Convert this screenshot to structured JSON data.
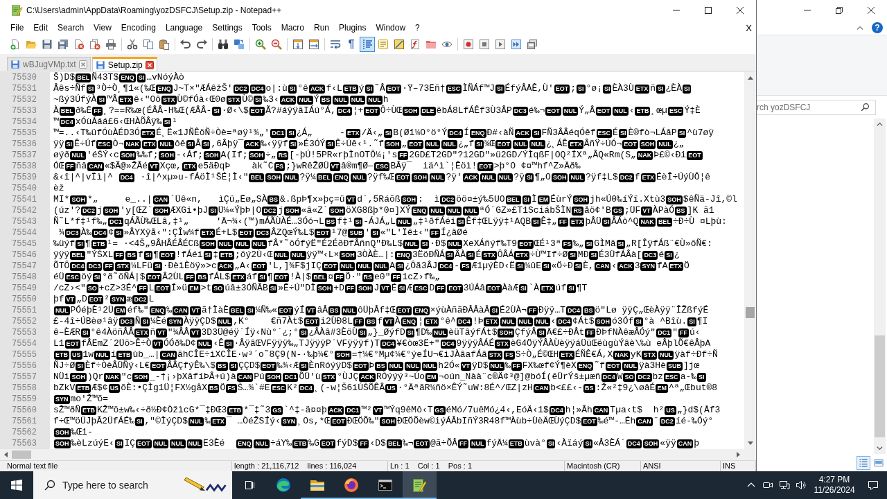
{
  "window": {
    "title": "C:\\Users\\admin\\AppData\\Roaming\\yozDSFCJ\\Setup.zip - Notepad++"
  },
  "menu": {
    "items": [
      "File",
      "Edit",
      "Search",
      "View",
      "Encoding",
      "Language",
      "Settings",
      "Tools",
      "Macro",
      "Run",
      "Plugins",
      "Window",
      "?"
    ],
    "close_glyph": "X"
  },
  "toolbar": {
    "buttons": [
      {
        "pressed": false
      },
      {
        "pressed": false
      },
      {
        "pressed": false
      },
      {
        "pressed": false
      },
      {
        "pressed": false
      },
      {
        "pressed": false
      },
      {
        "pressed": false
      },
      {
        "pressed": false
      },
      {
        "pressed": false
      },
      {
        "pressed": false
      },
      {
        "pressed": false
      },
      {
        "pressed": false
      },
      {
        "pressed": false
      },
      {
        "pressed": false
      },
      {
        "pressed": false
      },
      {
        "pressed": false
      },
      {
        "pressed": false
      },
      {
        "pressed": false
      },
      {
        "pressed": false
      },
      {
        "pressed": false,
        "glyph": "¶"
      },
      {
        "pressed": true
      },
      {
        "pressed": false
      },
      {
        "pressed": false
      },
      {
        "pressed": false
      },
      {
        "pressed": false
      },
      {
        "pressed": false
      },
      {
        "pressed": false
      },
      {
        "pressed": false
      },
      {
        "pressed": false
      },
      {
        "pressed": false
      },
      {
        "pressed": false
      }
    ]
  },
  "tabs": [
    {
      "label": "wBJugVMp.txt",
      "selected": false
    },
    {
      "label": "Setup.zip",
      "selected": true
    }
  ],
  "editor": {
    "lines": [
      {
        "number": "75530",
        "parts": [
          "Š)D$",
          {
            "code": "BEL"
          },
          "Ñ43T$",
          {
            "code": "ENQ"
          },
          {
            "code": "SI"
          },
          "…vNóýÀò"
        ]
      },
      {
        "number": "75531",
        "parts": [
          "Âês÷Ñf",
          {
            "code": "SI"
          },
          "³Ò÷Ò¸¶1«(‰Œ",
          {
            "code": "ENQ"
          },
          "J~T×\"ÆÁêžŠ'",
          {
            "code": "DC2"
          },
          {
            "code": "DC4"
          },
          "o|:ù",
          {
            "code": "SI"
          },
          "°ê",
          {
            "code": "ACK"
          },
          "f‹L",
          {
            "code": "ETB"
          },
          "ý",
          {
            "code": "SI"
          },
          "˜Â",
          {
            "code": "EOT"
          },
          "·Ÿ–73Ëñ†",
          {
            "code": "ESC"
          },
          "ÌÑÁf™J",
          {
            "code": "SI"
          },
          "ÉfýÂÅÊ,Ù'",
          {
            "code": "EOT"
          },
          ";",
          {
            "code": "SI"
          },
          "°ø¡",
          {
            "code": "SI"
          },
          "ÈÀ3Ù",
          {
            "code": "ETX"
          },
          "ñ",
          {
            "code": "SI"
          },
          "¿ÈÀ",
          {
            "code": "SI"
          }
        ]
      },
      {
        "number": "75532",
        "parts": [
          "~ßý3ÚfýÀ",
          {
            "code": "SI"
          },
          "™Â",
          {
            "code": "ETX"
          },
          "ê‹\"Oô",
          {
            "code": "STX"
          },
          "Ù©fÓà‹Œ0ø",
          {
            "code": "STX"
          },
          "Ù©",
          {
            "code": "SI"
          },
          "‰3‹",
          {
            "code": "ACK"
          },
          {
            "code": "NUL"
          },
          "Ý",
          {
            "code": "BS"
          },
          {
            "code": "NUL"
          },
          {
            "code": "NUL"
          },
          {
            "code": "NUL"
          },
          "h"
        ]
      },
      {
        "number": "75533",
        "parts": [
          "À",
          {
            "code": "BEL"
          },
          "ð‰Ë",
          {
            "code": "FF"
          },
          "¸?==R‰œ(ÉÂÂ-H‰Œ(ÆÂÂ-",
          {
            "code": "SI"
          },
          "·Ø‹\\$",
          {
            "code": "EOT"
          },
          "Ã?#áÿÿãIÁú°Á,",
          {
            "code": "DC4"
          },
          "¦+",
          {
            "code": "EOT"
          },
          "Ô÷ÙŒ",
          {
            "code": "SOH"
          },
          {
            "code": "DLE"
          },
          "ëbÁ8LfÁÊf3Ù3ÂP",
          {
            "code": "DC3"
          },
          "é‰¬",
          {
            "code": "EOT"
          },
          {
            "code": "NUL"
          },
          "Ý„Â",
          {
            "code": "EOT"
          },
          {
            "code": "NUL"
          },
          "‹",
          {
            "code": "ETB"
          },
          "¸œµ",
          {
            "code": "ESC"
          },
          "Ý‡È"
        ]
      },
      {
        "number": "75534",
        "parts": [
          "™",
          {
            "code": "DC4"
          },
          "xÓùÁáá£6‹ŒHÀÕÂÿ‰",
          {
            "code": "SI"
          },
          "¹"
        ]
      },
      {
        "number": "75535",
        "parts": [
          "™=..‹T‰üfÓùÀÉD3Ó",
          {
            "code": "ETX"
          },
          "É¸Ë«1JÑÊöÑ÷Òè=ªøÿ¹¾„'",
          {
            "code": "DC1"
          },
          {
            "code": "SI"
          },
          "¿Á„     -",
          {
            "code": "ETX"
          },
          "/Ä‹„",
          {
            "code": "SI"
          },
          "B(Øî¼O°ö°Ý",
          {
            "code": "DC4"
          },
          "Í",
          {
            "code": "ENQ"
          },
          "Ð#‹àÑ",
          {
            "code": "ACK"
          },
          {
            "code": "SI"
          },
          "FÑ3ÂÂéqÓêf",
          {
            "code": "ESC"
          },
          "É",
          {
            "code": "SI"
          },
          "È®fò¬LÁâP",
          {
            "code": "SI"
          },
          "^ù7øÿ"
        ]
      },
      {
        "number": "75536",
        "parts": [
          "ÿÿ",
          {
            "code": "SI"
          },
          "Ê÷Úf",
          {
            "code": "ESC"
          },
          "Ò¬",
          {
            "code": "NAK"
          },
          {
            "code": "ETX"
          },
          {
            "code": "NUL"
          },
          "ôê",
          {
            "code": "SI"
          },
          "Â",
          {
            "code": "SI"
          },
          ",6Âþÿ¯",
          {
            "code": "ACK"
          },
          "‰‹ÿÿf",
          {
            "code": "SI"
          },
          "»É3ÓÝ",
          {
            "code": "SI"
          },
          "Ê÷Úê‹¹.˜f",
          {
            "code": "SOH"
          },
          "„",
          {
            "code": "EOT"
          },
          {
            "code": "NUL"
          },
          {
            "code": "NUL"
          },
          "¿„f",
          {
            "code": "SI"
          },
          "¾Œ",
          {
            "code": "EOT"
          },
          {
            "code": "NUL"
          },
          {
            "code": "NUL"
          },
          "¿¸ÁÊ",
          {
            "code": "ETX"
          },
          "ÂñŸ÷ÚÓ¬",
          {
            "code": "EOT"
          },
          {
            "code": "SOH"
          },
          {
            "code": "NUL"
          },
          "¿„"
        ]
      },
      {
        "number": "75537",
        "parts": [
          "øýð",
          {
            "code": "NUL"
          },
          "'éŠÝ‹c",
          {
            "code": "SOH"
          },
          "‰‰f;",
          {
            "code": "SOH"
          },
          "-‹Áf;",
          {
            "code": "SOH"
          },
          "A(If;",
          {
            "code": "SOH"
          },
          "÷„",
          {
            "code": "RS"
          },
          "[-þÚ!5PR«rþÌnOTÔ¼¡'s",
          {
            "code": "FF"
          },
          "2GD£T2GD\"?12GD\"»ü2GD/ÝÌqßF|OQ²ÍXª„ÂQ«Rm(S„",
          {
            "code": "NAK"
          },
          "Þ£©‹Ði",
          {
            "code": "EOT"
          }
        ]
      },
      {
        "number": "75538",
        "parts": [
          "ÓŒ",
          {
            "code": "FF"
          },
          "ñâ",
          {
            "code": "CAN"
          },
          "«$Ã@»ŽÂé",
          {
            "code": "VT"
          },
          "Xçœ,",
          {
            "code": "ETX"
          },
          "e5äÐqÞ    àk˜C",
          {
            "code": "FS"
          },
          ";}wRêŽØÜ",
          {
            "code": "VT"
          },
          "â®m¶Ø—",
          {
            "code": "ESC"
          },
          "BÂÿ¯  iä^ì`¦Êöì!",
          {
            "code": "EOT"
          },
          ">þ°O ¢¤™hf^Z»Äð‰"
        ]
      },
      {
        "number": "75539",
        "parts": [
          "&‹î|^|vÏì|^ ",
          {
            "code": "DC4"
          },
          " ·î|^xµ»u-fÁöÌ¹ŠÉ¦Ì‹\"",
          {
            "code": "BEL"
          },
          {
            "code": "SOH"
          },
          {
            "code": "NUL"
          },
          "?ÿ¼",
          {
            "code": "BEL"
          },
          {
            "code": "ENQ"
          },
          {
            "code": "NUL"
          },
          "?ÿf‰Œ",
          {
            "code": "EOT"
          },
          {
            "code": "SOH"
          },
          {
            "code": "NUL"
          },
          "?ÿ'",
          {
            "code": "ACK"
          },
          {
            "code": "NUL"
          },
          {
            "code": "NUL"
          },
          "?ÿ",
          {
            "code": "SI"
          },
          "¶„O",
          {
            "code": "SOH"
          },
          {
            "code": "NUL"
          },
          "?ÿf‡L$",
          {
            "code": "DC2"
          },
          "f",
          {
            "code": "ETX"
          },
          "ÉèÎ÷ÚýÙÔ¦ê"
        ]
      },
      {
        "number": "75540",
        "parts": [
          "èž"
        ]
      },
      {
        "number": "75541",
        "parts": [
          "MI*",
          {
            "code": "SOH"
          },
          "*„     e_..|",
          {
            "code": "CAN"
          },
          "`Üê«n,   ìÇü„Ëø„SÀ",
          {
            "code": "BS"
          },
          "&.ßpÞ¶x»þç=ü",
          {
            "code": "VT"
          },
          "d`,5Ráõß",
          {
            "code": "SOH"
          },
          ":  ì",
          {
            "code": "DC2"
          },
          "öö¤±ý‰5UO",
          {
            "code": "BEL"
          },
          {
            "code": "SI"
          },
          "Ì",
          {
            "code": "EM"
          },
          "ÉùrÝ",
          {
            "code": "SOH"
          },
          "jh«Ú0‰íÝï.Xtù3",
          {
            "code": "SOH"
          },
          "$êÑä-Jî,©l"
        ]
      },
      {
        "number": "75542",
        "parts": [
          "(úz'?",
          {
            "code": "DC2"
          },
          "j",
          {
            "code": "SOH"
          },
          "'y[ŒZ`",
          {
            "code": "SOH"
          },
          "ÆXGi•þJ",
          {
            "code": "SI"
          },
          "Ü¼«ÝþÞ|O",
          {
            "code": "DC2"
          },
          "j",
          {
            "code": "SOH"
          },
          "«â«Z`",
          {
            "code": "SOH"
          },
          "öXG8ßþ*0¤]XÝ",
          {
            "code": "ENQ"
          },
          {
            "code": "NUL"
          },
          {
            "code": "NUL"
          },
          {
            "code": "NUL"
          },
          "ªÓ´GZ»£T1SciábŠÌN",
          {
            "code": "RS"
          },
          "åö¢'B",
          {
            "code": "GS"
          },
          ";ÜF",
          {
            "code": "VT"
          },
          "ÀPàÓ",
          {
            "code": "BS"
          },
          "]K ã1"
        ]
      },
      {
        "number": "75543",
        "parts": [
          "Ñ˜L*f‡¹f‰„",
          {
            "code": "DC1"
          },
          "qÁÃÙ‰ŒLâ,‡¹„     'Ä¬¾‹(™)mÁÃÙÀÉ…3Óó¬L",
          {
            "code": "BS"
          },
          "f‡¹",
          {
            "code": "SI"
          },
          "-ÁJÁ„L",
          {
            "code": "NUL"
          },
          "„‡¹ðfÁéi",
          {
            "code": "SI"
          },
          "Êf‡ŒLÿÿ‡¹AQB",
          {
            "code": "SI"
          },
          "Ê‡„",
          {
            "code": "FF"
          },
          {
            "code": "ETX"
          },
          "þÂÜ",
          {
            "code": "SI"
          },
          "ÂÁò^Q",
          {
            "code": "NAK"
          },
          {
            "code": "BEL"
          },
          "÷Ð÷Ù ¤Lþù:"
        ]
      },
      {
        "number": "75544",
        "parts": [
          " ¾",
          {
            "code": "DC3"
          },
          "À‰",
          {
            "code": "DC4"
          },
          "¢",
          {
            "code": "SI"
          },
          "»ÂYXÿå‹\":ÇÎw¼f",
          {
            "code": "ETX"
          },
          "É+L$",
          {
            "code": "EOT"
          },
          {
            "code": "DC3"
          },
          "ÂZQœÝ‰L$",
          {
            "code": "EOT"
          },
          "¹7@",
          {
            "code": "SUB"
          },
          "'",
          {
            "code": "SI"
          },
          "«\"L'Ïë±‹\"",
          {
            "code": "FF"
          },
          "Í¿âØé"
        ]
      },
      {
        "number": "75545",
        "parts": [
          "‰üýf",
          {
            "code": "SI"
          },
          "¶",
          {
            "code": "ETB"
          },
          "¹= ·<4Š„9ÂHÂÉÂÉCß",
          {
            "code": "SOH"
          },
          {
            "code": "NUL"
          },
          {
            "code": "NUL"
          },
          {
            "code": "NUL"
          },
          "fÂ*˜öÓfýË\"É2ÉðÐfÂñnQ\"Ð‰L$",
          {
            "code": "NUL"
          },
          {
            "code": "SI"
          },
          "·Ð$",
          {
            "code": "NUL"
          },
          "XeXÁñýf‰T9",
          {
            "code": "EOT"
          },
          "ŒÉ¹3ª",
          {
            "code": "FS"
          },
          "‰„",
          {
            "code": "SI"
          },
          "GÌMâ",
          {
            "code": "SI"
          },
          "„R[ÎÿfÁß¨€Ù»õÑ€:"
        ]
      },
      {
        "number": "75546",
        "parts": [
          "ÿÿÿ",
          {
            "code": "BEL"
          },
          "\"ÝŠXL",
          {
            "code": "FF"
          },
          {
            "code": "BS"
          },
          "f",
          {
            "code": "SI"
          },
          "¶",
          {
            "code": "EOT"
          },
          "!fÁéi",
          {
            "code": "SI"
          },
          "‡",
          {
            "code": "ETB"
          },
          ";öý2Ù‹Œ",
          {
            "code": "NUL"
          },
          {
            "code": "NUL"
          },
          "ÿÿ™‹L×",
          {
            "code": "SOH"
          },
          "3ÒÀÈ…|:",
          {
            "code": "ENQ"
          },
          "3ËöÐÑÁ",
          {
            "code": "SI"
          },
          "ÂÀ",
          {
            "code": "SI"
          },
          "É",
          {
            "code": "STX"
          },
          "ÔÂÁ",
          {
            "code": "ETX"
          },
          "÷Ù™If÷Ø",
          {
            "code": "SI"
          },
          "MÐ",
          {
            "code": "SI"
          },
          "É3ÜfÁÂà[",
          {
            "code": "DC3"
          },
          "é",
          {
            "code": "SI"
          },
          "¿"
        ]
      },
      {
        "number": "75547",
        "parts": [
          "ÕTÔ",
          {
            "code": "DC4"
          },
          {
            "code": "DC3"
          },
          {
            "code": "FF"
          },
          {
            "code": "STX"
          },
          "¼LFü",
          {
            "code": "SI"
          },
          "·ÐèìÈöÿ»>c",
          {
            "code": "ACK"
          },
          "„A‹",
          {
            "code": "EOT"
          },
          "'L,]¾F$jIÇ",
          {
            "code": "EOT"
          },
          {
            "code": "NUL"
          },
          {
            "code": "NUL"
          },
          {
            "code": "NUL"
          },
          "A",
          {
            "code": "SI"
          },
          "¿Ôã3ÂJ",
          {
            "code": "DC4"
          },
          "-",
          {
            "code": "FS"
          },
          "Æ1µýÈD‹Ë",
          {
            "code": "SI"
          },
          "¼ûE",
          {
            "code": "SI"
          },
          "«Ö÷Ð",
          {
            "code": "SI"
          },
          "È,",
          {
            "code": "CAN"
          },
          "‹",
          {
            "code": "ACK"
          },
          "3",
          {
            "code": "SYN"
          },
          "fA",
          {
            "code": "ETX"
          },
          "Ö"
        ]
      },
      {
        "number": "75548",
        "parts": [
          "éÜ",
          {
            "code": "ESC"
          },
          "öý",
          {
            "code": "SI"
          },
          "°ð˜öÑÁ|$",
          {
            "code": "EOT"
          },
          "Â2ÙL",
          {
            "code": "FF"
          },
          {
            "code": "BS"
          },
          "fÁL$",
          {
            "code": "ETX"
          },
          "áf",
          {
            "code": "SI"
          },
          "¶",
          {
            "code": "EOT"
          },
          "!À|$",
          {
            "code": "BEL"
          },
          "¤",
          {
            "code": "FF"
          },
          "Õ·\"",
          {
            "code": "RS"
          },
          "e0\"",
          {
            "code": "FF"
          },
          "1cZ›f‰„"
        ]
      },
      {
        "number": "75549",
        "parts": [
          "/cZ›<\"",
          {
            "code": "SO"
          },
          "+cZ>3É^",
          {
            "code": "FF"
          },
          "L",
          {
            "code": "EOT"
          },
          "Í»ü",
          {
            "code": "EM"
          },
          ">t",
          {
            "code": "SO"
          },
          "úâ±3ÓÑÂB",
          {
            "code": "SI"
          },
          "»Ê÷Ú\"DÌ",
          {
            "code": "SOH"
          },
          "+D",
          {
            "code": "FF"
          },
          {
            "code": "SOH"
          },
          "J",
          {
            "code": "VT"
          },
          "É",
          {
            "code": "SI"
          },
          "Æ",
          {
            "code": "ESC"
          },
          "D",
          {
            "code": "FF"
          },
          {
            "code": "EOT"
          },
          "3ÚÁâ",
          {
            "code": "EOT"
          },
          "ÀàÆ",
          {
            "code": "SI"
          },
          "`À",
          {
            "code": "ETX"
          },
          "úf",
          {
            "code": "SI"
          },
          "¶T"
        ]
      },
      {
        "number": "75550",
        "parts": [
          "þf",
          {
            "code": "VT"
          },
          "„D",
          {
            "code": "EOT"
          },
          "²",
          {
            "code": "SYN"
          },
          "æ",
          {
            "code": "DC2"
          },
          "L"
        ]
      },
      {
        "number": "75551",
        "parts": [
          {
            "code": "NUL"
          },
          "PÓéþÈ¹2Ü",
          {
            "code": "EM"
          },
          "éf‰\"",
          {
            "code": "ENQ"
          },
          "‰",
          {
            "code": "CAN"
          },
          {
            "code": "VT"
          },
          "ã†ÌàÈ",
          {
            "code": "BEL"
          },
          {
            "code": "SI"
          },
          "¼Ñ‰«",
          {
            "code": "EOT"
          },
          "ýÍ",
          {
            "code": "VT"
          },
          "âÂ",
          {
            "code": "BS"
          },
          {
            "code": "NUL"
          },
          "ôÜþÂf‡Œ",
          {
            "code": "EOT"
          },
          {
            "code": "ENQ"
          },
          "×ýùÀñãÐÂÂàÂ",
          {
            "code": "SI"
          },
          "É2ÙÀ¬",
          {
            "code": "FF"
          },
          "Ðÿÿ…T",
          {
            "code": "DC4"
          },
          {
            "code": "BS"
          },
          "ö\"Lø ÿÿÇ„ŒèÀÿÿ¨ÎŽßfýÉ"
        ]
      },
      {
        "number": "75552",
        "parts": [
          "£-4î÷ÚBèø¹âÿ",
          {
            "code": "DC3"
          },
          "Ñ",
          {
            "code": "SI"
          },
          "¼Èé",
          {
            "code": "SYN"
          },
          "ÀÿÿÇD$",
          {
            "code": "NUL"
          },
          ",K°    €ñ7Àt$",
          {
            "code": "EOT"
          },
          "i2ÙÐ8L",
          {
            "code": "FF"
          },
          {
            "code": "BS"
          },
          "f",
          {
            "code": "VT"
          },
          "À",
          {
            "code": "ENQ"
          },
          "¦",
          {
            "code": "ETX"
          },
          "°ê^",
          {
            "code": "DC4"
          },
          "!Þ",
          {
            "code": "ETX"
          },
          {
            "code": "NUL"
          },
          {
            "code": "NUL"
          },
          {
            "code": "NUL"
          },
          "‹",
          {
            "code": "DC4"
          },
          "¢Át$",
          {
            "code": "SOH"
          },
          "ó3Óf",
          {
            "code": "SI"
          },
          "°à ^Bîù.",
          {
            "code": "SI"
          },
          "¶I"
        ]
      },
      {
        "number": "75553",
        "parts": [
          "ê–ÈÆR",
          {
            "code": "SI"
          },
          "°ê4ÀöñÂÂ",
          {
            "code": "ETX"
          },
          "ñ",
          {
            "code": "VT"
          },
          "\"¾ÂÂ",
          {
            "code": "VT"
          },
          "3D3Ü@éÿ`Íÿ‹Nù°´¿;°",
          {
            "code": "SI"
          },
          "¿ÂÀâ#3ÈöÙ",
          {
            "code": "SI"
          },
          "„}_ØýfD",
          {
            "code": "SI"
          },
          "¶D‰",
          {
            "code": "NUL"
          },
          "èüTâýfÁt$",
          {
            "code": "SOH"
          },
          "ÇfýÂ",
          {
            "code": "SI"
          },
          "Ä€£÷ÐÂt",
          {
            "code": "FF"
          },
          "ÐÞfNÀêæÂÓý\"",
          {
            "code": "DC1"
          },
          "\"",
          {
            "code": "FF"
          },
          "ú‹"
        ]
      },
      {
        "number": "75554",
        "parts": [
          "L1",
          {
            "code": "EOT"
          },
          "fÂËmZ´2Üõ>Ê÷Ò",
          {
            "code": "VT"
          },
          "ÓÓð‰D¢",
          {
            "code": "NUL"
          },
          "‹Ê",
          {
            "code": "SI"
          },
          "·ÂÿâŒVFÿÿÿ‰„TJÿÿÿP´VFÿÿÿf)T",
          {
            "code": "DC4"
          },
          "¥€òœ3Ë+\"",
          {
            "code": "DC4"
          },
          "9ÿÿÿÂÁÉ",
          {
            "code": "STX"
          },
          "èG4ÖÿÝÂÀÙèÿÿáÜüŒëùgùÝâè\\‰ù eÂþlÕ€êÂþA"
        ]
      },
      {
        "number": "75555",
        "parts": [
          {
            "code": "ETB"
          },
          {
            "code": "US"
          },
          "1w",
          {
            "code": "NUL"
          },
          "í",
          {
            "code": "ETB"
          },
          "ùb_…|",
          {
            "code": "CAN"
          },
          "ãhCÎE÷ìXCÎE·w³´o˜8Ç9(N-·‰þ¼€°",
          {
            "code": "SOH"
          },
          "=†¼€°Mµ¢¼€°ýeÍU¬€iJÀâafÁâ",
          {
            "code": "STX"
          },
          {
            "code": "FS"
          },
          "S÷Ò„É©ŒH",
          {
            "code": "ETX"
          },
          "ÉÑÊ€Á,X",
          {
            "code": "NAK"
          },
          "yK",
          {
            "code": "STX"
          },
          {
            "code": "NUL"
          },
          "ÿàf÷Ðf÷Ñ"
        ]
      },
      {
        "number": "75556",
        "parts": [
          "ÑJ÷Ø",
          {
            "code": "SI"
          },
          "Èf÷ÒèÂÜÑý‹L€",
          {
            "code": "EOT"
          },
          "ÂÂÇfýÊ‰\\$",
          {
            "code": "BS"
          },
          {
            "code": "SI"
          },
          "ÇÇD$",
          {
            "code": "EOT"
          },
          "‰¾‹Æ",
          {
            "code": "SI"
          },
          "ÈnRóýÿD$",
          {
            "code": "EOT"
          },
          "Þ",
          {
            "code": "BS"
          },
          {
            "code": "NUL"
          },
          {
            "code": "NUL"
          },
          {
            "code": "NUL"
          },
          "h2Ó«",
          {
            "code": "VT"
          },
          "ÿD$",
          {
            "code": "NUL"
          },
          "‰",
          {
            "code": "FF"
          },
          "FX‰œf¢Ý¶èX",
          {
            "code": "ENQ"
          },
          "˜f",
          {
            "code": "EOT"
          },
          {
            "code": "NUL"
          },
          "ÿà3Hè",
          {
            "code": "SUB"
          },
          "]jœ"
        ]
      },
      {
        "number": "75557",
        "parts": [
          "NÜi",
          {
            "code": "SOH"
          },
          ")Qr",
          {
            "code": "NAK"
          },
          "\"c",
          {
            "code": "SOH"
          },
          "_-†¡›þXâfíÞÂ+ú)à",
          {
            "code": "CAN"
          },
          "Pú",
          {
            "code": "SOH"
          },
          {
            "code": "DC1"
          },
          "ÕÜ'ù",
          {
            "code": "STX"
          },
          "°ÙJÇ",
          {
            "code": "ACK"
          },
          "RÒýýý³~Úo",
          {
            "code": "EM"
          },
          "¬oún_Nàà¨c®Ä¢³@]@bóÍ(êÜrÝš±µæñ",
          {
            "code": "DC4"
          },
          "W",
          {
            "code": "SO"
          },
          {
            "code": "DC2"
          },
          "bz",
          {
            "code": "ESC"
          },
          "a-‰",
          {
            "code": "SI"
          }
        ]
      },
      {
        "number": "75558",
        "parts": [
          "bZkV",
          {
            "code": "ETB"
          },
          "Æ$¢",
          {
            "code": "US"
          },
          "õÈ:•ÇÌg1Ü¦FX½gåX",
          {
            "code": "BS"
          },
          "Ö",
          {
            "code": "FS"
          },
          "Š…¾`#E",
          {
            "code": "ESC"
          },
          "K²",
          {
            "code": "DC4"
          },
          "¸(-w¦Š6iÚŠÕÊÂ",
          {
            "code": "US"
          },
          "·°ÄªãR¼ñö×ÊÝ˜uW:8É^/ŒZ|zH",
          {
            "code": "CAN"
          },
          "b<££‹-",
          {
            "code": "BS"
          },
          ":Ž«²‡9¿\\øâÉ",
          {
            "code": "EM"
          },
          "^ª„Œbut®8"
        ]
      },
      {
        "number": "75559",
        "parts": [
          {
            "code": "SYN"
          },
          "mo'Ž™õ="
        ]
      },
      {
        "number": "75560",
        "parts": [
          "sŽ™ðÑ",
          {
            "code": "ETB"
          },
          "KŽ™ö±w‰‹÷ð½Ð¢ÒžìcG*¯‡ÐŒ3",
          {
            "code": "ETB"
          },
          "*¯‡˜3",
          {
            "code": "GS"
          },
          "`^‡-ä¤¤þ",
          {
            "code": "ACK"
          },
          {
            "code": "DC1"
          },
          "™²",
          {
            "code": "VT"
          },
          "™Ýq9êMô‹T",
          {
            "code": "GS"
          },
          "éMó/7uêMó¿4‹,EóÄ‹1$",
          {
            "code": "DC4"
          },
          "h¦»Âh",
          {
            "code": "CAN"
          },
          "Tµa‹t$  h²",
          {
            "code": "US"
          },
          "„}d$(Åf3"
        ]
      },
      {
        "number": "75561",
        "parts": [
          "f÷Œ™öÜJþÂ2ÜfÁÉ‰",
          {
            "code": "SI"
          },
          ",\"©ÌýÇD$",
          {
            "code": "NUL"
          },
          "‰",
          {
            "code": "ETX"
          },
          "¯ …ÒéŽSÍý‹",
          {
            "code": "SYN"
          },
          "¸Os,*Œ",
          {
            "code": "EOT"
          },
          "ÐŒÖÕ‰\"",
          {
            "code": "SOH"
          },
          "ÐŒÖÕèw©iýÁÂbIñÝ3R48f™Àùb÷ÙèÄŒÙýÇD$",
          {
            "code": "EOT"
          },
          "‰é™-…Éh",
          {
            "code": "CAN"
          },
          "¨",
          {
            "code": "DC2"
          },
          "íé-‰Óý°"
        ]
      },
      {
        "number": "75562",
        "parts": [
          {
            "code": "SOH"
          },
          "‰Œ1-"
        ]
      },
      {
        "number": "75563",
        "parts": [
          {
            "code": "SOH"
          },
          "‰èLzúýE‹",
          {
            "code": "SI"
          },
          "IÇ",
          {
            "code": "EOT"
          },
          {
            "code": "NUL"
          },
          {
            "code": "NUL"
          },
          {
            "code": "NUL"
          },
          "E3Èé  ",
          {
            "code": "ENQ"
          },
          {
            "code": "NUL"
          },
          "÷áY‰",
          {
            "code": "ETB"
          },
          "‰G",
          {
            "code": "EOT"
          },
          "fýD$",
          {
            "code": "FF"
          },
          "‹D$",
          {
            "code": "BEL"
          },
          "‰¬",
          {
            "code": "EOT"
          },
          "@ã÷ÕÂ",
          {
            "code": "FF"
          },
          {
            "code": "NUL"
          },
          "fýÄ¼",
          {
            "code": "ETB"
          },
          "ùvà°",
          {
            "code": "SI"
          },
          "‹Àïáý",
          {
            "code": "SI"
          },
          "«Â3ÈÁ´",
          {
            "code": "DC4"
          },
          {
            "code": "SOH"
          },
          "«ÿÿ",
          {
            "code": "CAN"
          },
          "þ"
        ]
      }
    ]
  },
  "status_bar": {
    "items": [
      "Normal text file",
      "length : 21,116,712    lines : 116,024",
      "Ln : 1    Col : 1    Pos : 1",
      "Macintosh (CR)",
      "ANSI",
      "INS"
    ]
  },
  "background_window": {
    "help_glyph": "?",
    "search": {
      "placeholder": "rch yozDSFCJ"
    },
    "view_buttons": [
      {
        "selected": true
      },
      {
        "selected": false
      }
    ]
  },
  "taskbar": {
    "search": {
      "placeholder": "Type here to search"
    },
    "apps": [
      {
        "running": false,
        "selected": false
      },
      {
        "running": true,
        "selected": false
      },
      {
        "running": true,
        "selected": false
      },
      {
        "running": true,
        "selected": false
      },
      {
        "running": true,
        "selected": true
      }
    ],
    "clock": {
      "time": "4:27 PM",
      "date": "11/26/2024"
    }
  }
}
